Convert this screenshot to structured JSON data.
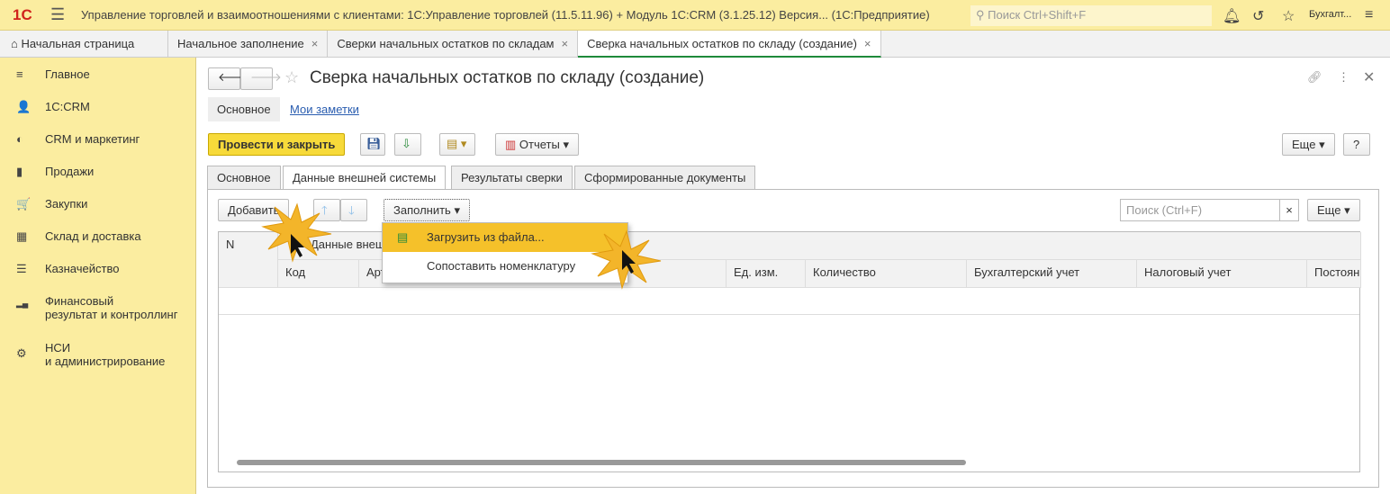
{
  "titlebar": {
    "logo": "1С",
    "title": "Управление торговлей и взаимоотношениями с клиентами: 1С:Управление торговлей (11.5.11.96) + Модуль 1С:CRM (3.1.25.12) Версия...   (1С:Предприятие)",
    "search_placeholder": "Поиск Ctrl+Shift+F",
    "user": "Бухгалт..."
  },
  "open_tabs": [
    {
      "label": "Начальная страница"
    },
    {
      "label": "Начальное заполнение"
    },
    {
      "label": "Сверки начальных остатков по складам"
    },
    {
      "label": "Сверка начальных остатков по складу (создание)"
    }
  ],
  "sidebar": {
    "items": [
      {
        "label": "Главное",
        "icon": "≡"
      },
      {
        "label": "1С:CRM",
        "icon": "👤"
      },
      {
        "label": "CRM и маркетинг",
        "icon": "◐"
      },
      {
        "label": "Продажи",
        "icon": "▮"
      },
      {
        "label": "Закупки",
        "icon": "🛒"
      },
      {
        "label": "Склад и доставка",
        "icon": "▦"
      },
      {
        "label": "Казначейство",
        "icon": "☰"
      },
      {
        "label": "Финансовый",
        "label2": "результат и контроллинг",
        "icon": "▂▄"
      },
      {
        "label": "НСИ",
        "label2": "и администрирование",
        "icon": "⚙"
      }
    ]
  },
  "form": {
    "title": "Сверка начальных остатков по складу (создание)",
    "subtabs": [
      "Основное",
      "Мои заметки"
    ],
    "post_close": "Провести и закрыть",
    "reports": "Отчеты",
    "more": "Еще",
    "help": "?",
    "tabs": [
      "Основное",
      "Данные внешней системы",
      "Результаты сверки",
      "Сформированные документы"
    ],
    "add": "Добавить",
    "fill": "Заполнить",
    "search_placeholder": "Поиск (Ctrl+F)",
    "clear": "×",
    "more2": "Еще",
    "menu": [
      "Загрузить из файла...",
      "Сопоставить номенклатуру"
    ],
    "columns": {
      "n": "N",
      "group": "Данные внешней системы",
      "code": "Код",
      "article": "Артикул",
      "unit": "Ед. изм.",
      "qty": "Количество",
      "acc": "Бухгалтерский учет",
      "tax": "Налоговый учет",
      "perm": "Постоян"
    }
  }
}
